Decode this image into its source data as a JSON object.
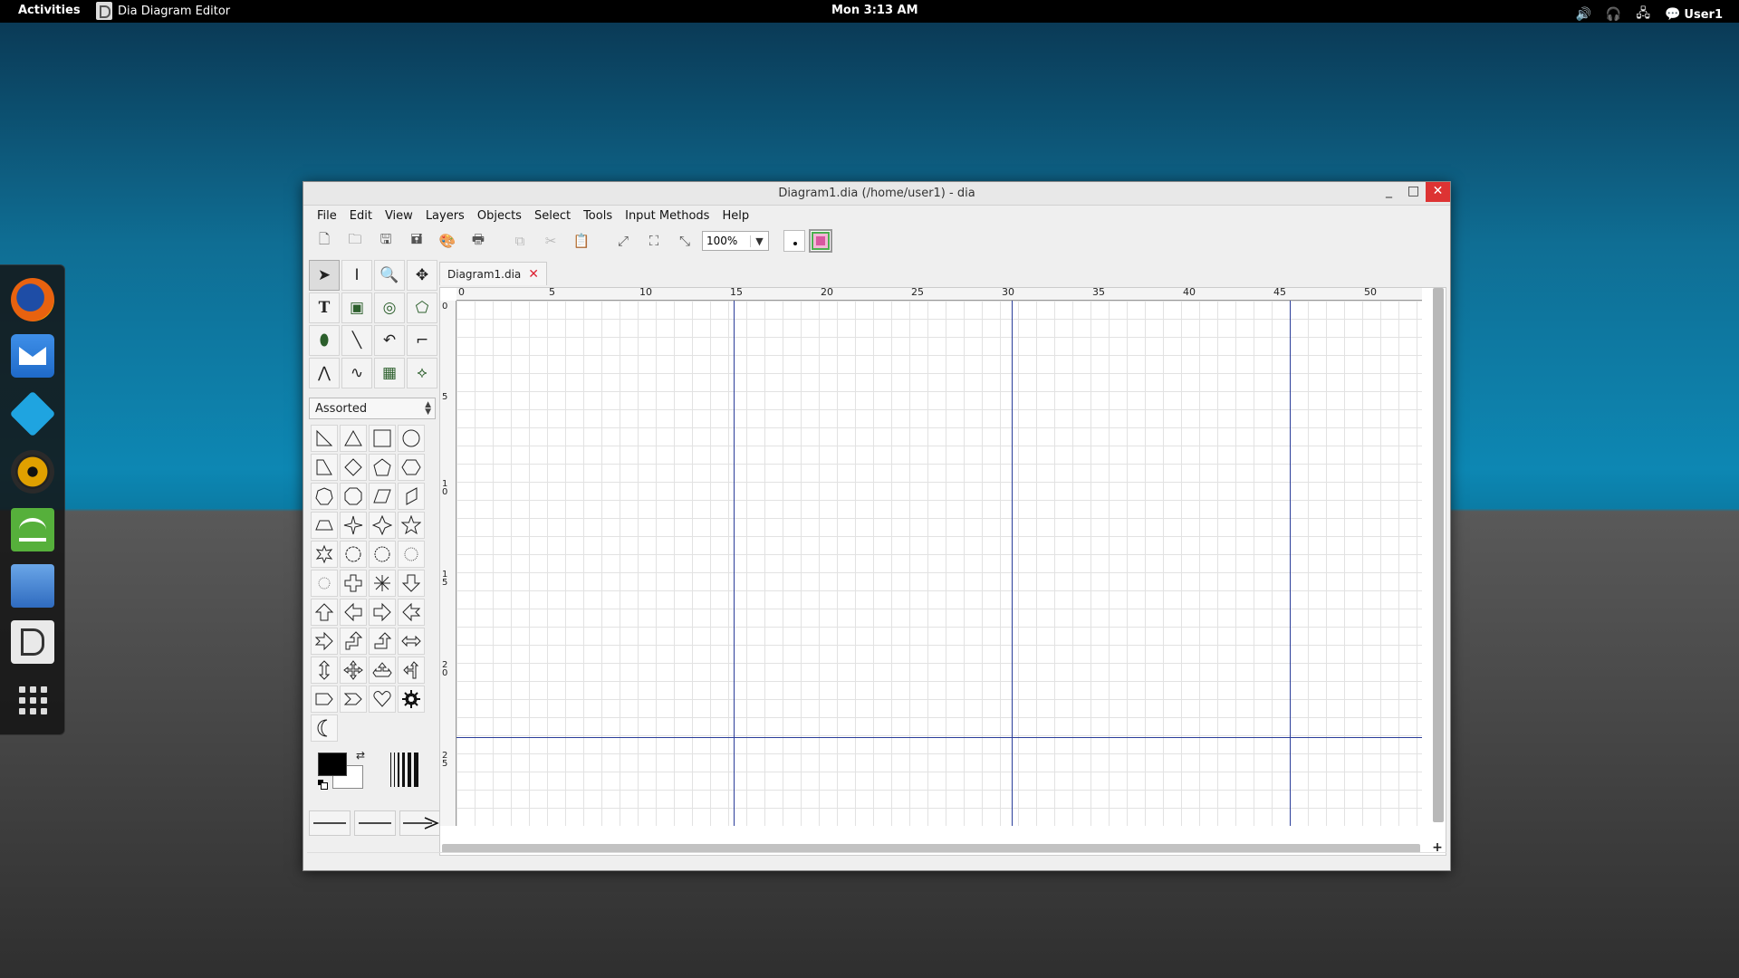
{
  "topbar": {
    "activities": "Activities",
    "app_name": "Dia Diagram Editor",
    "clock": "Mon  3:13 AM",
    "user": "User1"
  },
  "dock": {
    "items": [
      "firefox",
      "thunderbird-mail",
      "kodi",
      "rhythmbox",
      "spotify",
      "files",
      "dia",
      "show-applications"
    ]
  },
  "window": {
    "title": "Diagram1.dia (/home/user1) - dia",
    "controls": {
      "minimize": "_",
      "maximize": "□",
      "close": "✕"
    }
  },
  "menu": [
    "File",
    "Edit",
    "View",
    "Layers",
    "Objects",
    "Select",
    "Tools",
    "Input Methods",
    "Help"
  ],
  "toolbar": {
    "zoom": "100%"
  },
  "toolbox": {
    "sheet": "Assorted"
  },
  "document": {
    "tab_label": "Diagram1.dia"
  },
  "rulers": {
    "horizontal": [
      "0",
      "5",
      "10",
      "15",
      "20",
      "25",
      "30",
      "35",
      "40",
      "45",
      "50"
    ],
    "vertical": [
      "0",
      "5",
      "1\n0",
      "1\n5",
      "2\n0",
      "2\n5"
    ]
  },
  "colors": {
    "foreground": "#000000",
    "background": "#ffffff",
    "page_break": "#2a3d9a",
    "close_button": "#dd3333"
  }
}
